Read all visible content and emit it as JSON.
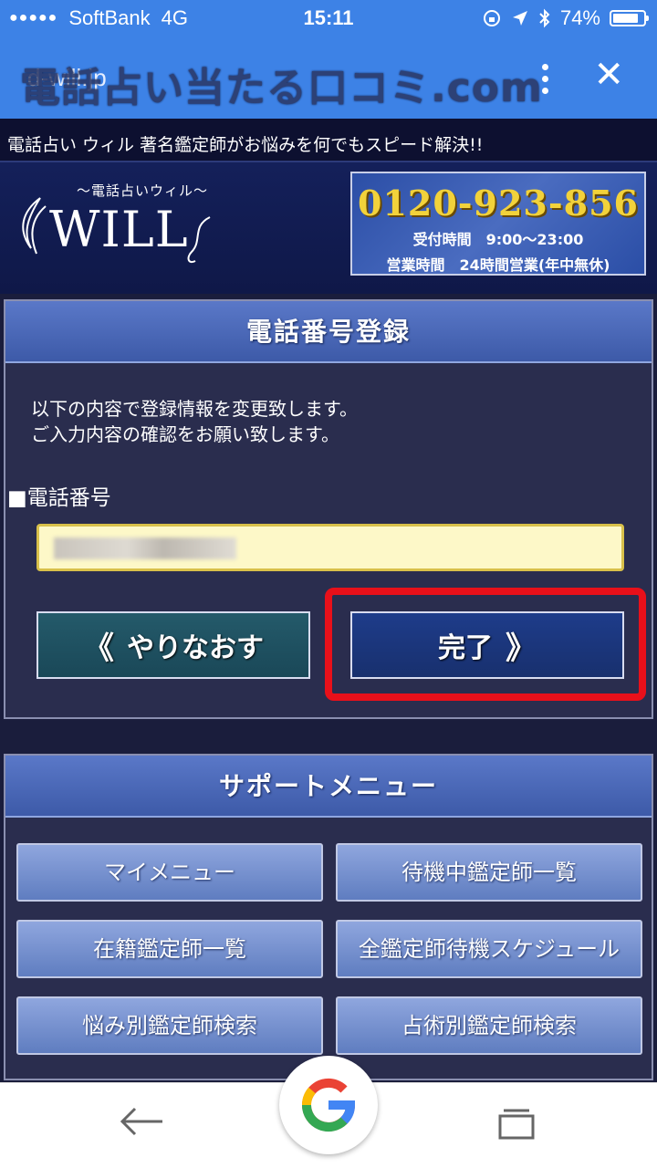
{
  "status": {
    "signal": "●●●●●",
    "carrier": "SoftBank",
    "network": "4G",
    "time": "15:11",
    "battery": "74%",
    "battery_level": 0.74
  },
  "browser": {
    "domain": "d-will.jp",
    "overlay_title": "電話占い当たる口コミ.com"
  },
  "site": {
    "tagline": "電話占い ウィル 著名鑑定師がお悩みを何でもスピード解決!!",
    "logo_sub": "〜電話占いウィル〜",
    "logo_word": "WILL",
    "phone": "0120-923-856",
    "reception": "受付時間　9:00〜23:00",
    "business": "営業時間　24時間営業(年中無休)"
  },
  "registration": {
    "title": "電話番号登録",
    "message_line1": "以下の内容で登録情報を変更致します。",
    "message_line2": "ご入力内容の確認をお願い致します。",
    "field_label": "■電話番号",
    "redo_label": "やりなおす",
    "done_label": "完了",
    "chevron_left": "《",
    "chevron_right": "》"
  },
  "support": {
    "title": "サポートメニュー",
    "buttons": [
      "マイメニュー",
      "待機中鑑定師一覧",
      "在籍鑑定師一覧",
      "全鑑定師待機スケジュール",
      "悩み別鑑定師検索",
      "占術別鑑定師検索"
    ]
  },
  "colors": {
    "highlight": "#e8101a",
    "browser_bar": "#3d82e6",
    "phone_number": "#f2d23b"
  }
}
